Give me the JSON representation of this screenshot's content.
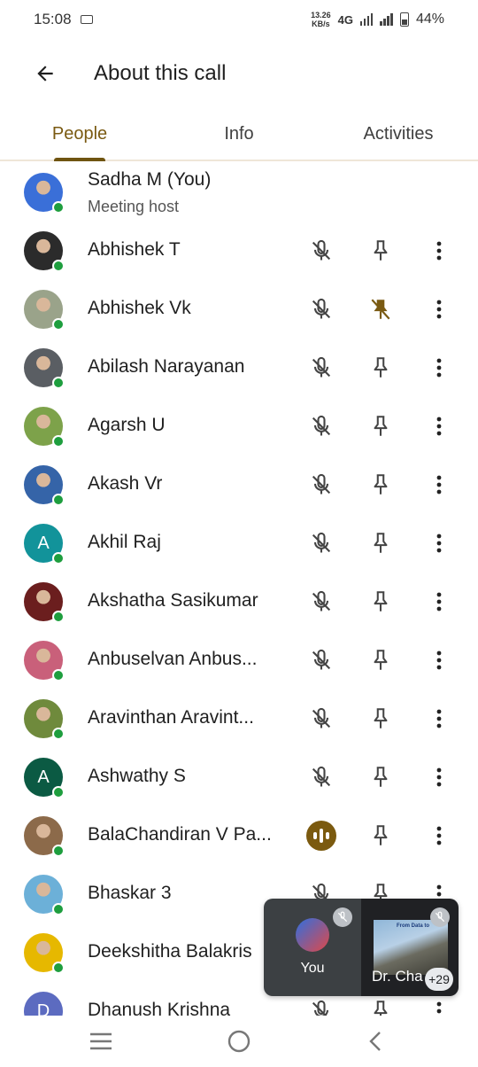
{
  "status_bar": {
    "time": "15:08",
    "speed_value": "13.26",
    "speed_unit": "KB/s",
    "network": "4G",
    "battery": "44%"
  },
  "app_bar": {
    "title": "About this call"
  },
  "tabs": [
    {
      "label": "People",
      "active": true
    },
    {
      "label": "Info",
      "active": false
    },
    {
      "label": "Activities",
      "active": false
    }
  ],
  "people": [
    {
      "name": "Sadha M (You)",
      "subtitle": "Meeting host",
      "avatar": "photo",
      "avatar_color": "#3a6fd8"
    },
    {
      "name": "Abhishek T",
      "avatar": "photo",
      "avatar_color": "#2b2b2b",
      "mic": "muted",
      "pinned": false
    },
    {
      "name": "Abhishek Vk",
      "avatar": "photo",
      "avatar_color": "#9aa38a",
      "mic": "muted",
      "pinned": true
    },
    {
      "name": "Abilash Narayanan",
      "avatar": "photo",
      "avatar_color": "#5a5e63",
      "mic": "muted",
      "pinned": false
    },
    {
      "name": "Agarsh U",
      "avatar": "photo",
      "avatar_color": "#7da24a",
      "mic": "muted",
      "pinned": false
    },
    {
      "name": "Akash Vr",
      "avatar": "photo",
      "avatar_color": "#3564a8",
      "mic": "muted",
      "pinned": false
    },
    {
      "name": "Akhil Raj",
      "avatar": "letter",
      "letter": "A",
      "avatar_color": "#12939a",
      "mic": "muted",
      "pinned": false
    },
    {
      "name": "Akshatha Sasikumar",
      "avatar": "photo",
      "avatar_color": "#6b1e1e",
      "mic": "muted",
      "pinned": false
    },
    {
      "name": "Anbuselvan Anbus...",
      "avatar": "photo",
      "avatar_color": "#c9607a",
      "mic": "muted",
      "pinned": false
    },
    {
      "name": "Aravinthan Aravint...",
      "avatar": "photo",
      "avatar_color": "#6f8a3c",
      "mic": "muted",
      "pinned": false
    },
    {
      "name": "Ashwathy S",
      "avatar": "letter",
      "letter": "A",
      "avatar_color": "#0b5a43",
      "mic": "muted",
      "pinned": false
    },
    {
      "name": "BalaChandiran V Pa...",
      "avatar": "photo",
      "avatar_color": "#8c6a4a",
      "mic": "speaking",
      "pinned": false
    },
    {
      "name": "Bhaskar 3",
      "avatar": "photo",
      "avatar_color": "#6cb0d8",
      "mic": "muted",
      "pinned": false
    },
    {
      "name": "Deekshitha Balakris",
      "avatar": "photo",
      "avatar_color": "#e6b800",
      "mic": "muted",
      "pinned": false
    },
    {
      "name": "Dhanush Krishna",
      "avatar": "letter",
      "letter": "D",
      "avatar_color": "#5c6bc0",
      "mic": "muted",
      "pinned": false
    }
  ],
  "pip": {
    "self_label": "You",
    "other_label": "Dr. Cha",
    "thumb_title": "From Data to",
    "more_count": "+29"
  },
  "colors": {
    "accent": "#7a5a12",
    "online": "#1e9e3e"
  }
}
